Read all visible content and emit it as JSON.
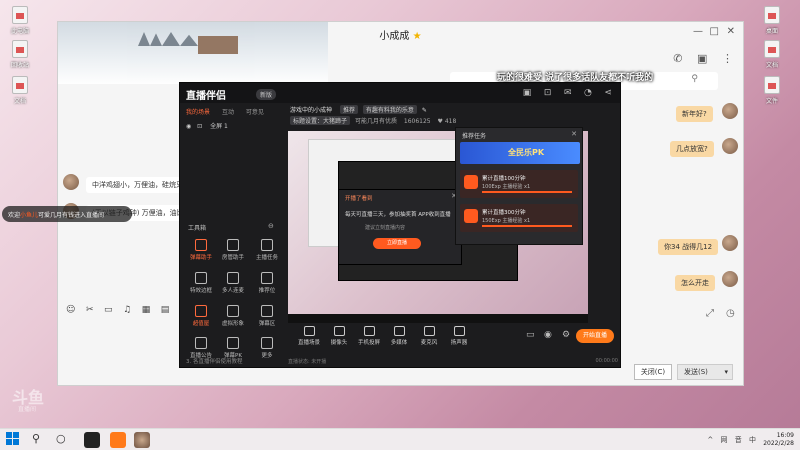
{
  "desktop": {
    "icons": [
      {
        "label": "此电脑",
        "side": "left"
      },
      {
        "label": "回收站",
        "side": "left"
      },
      {
        "label": "文档",
        "side": "left"
      },
      {
        "label": "桌面",
        "side": "right"
      },
      {
        "label": "文档",
        "side": "right"
      },
      {
        "label": "文件",
        "side": "right"
      }
    ]
  },
  "chat": {
    "title": "小成成",
    "title_badge": "★",
    "icons": [
      "phone-icon",
      "video-icon",
      "more-icon"
    ],
    "messages_left": [
      "中洋鸡翅小，万俚油，硅烷牙",
      "(无以链子鸡钟) 万俚油，油比，"
    ],
    "messages_right": [
      "新年好?",
      "几点放宽?",
      "你34 战得几12",
      "怎么开走"
    ],
    "toolbar_icons": [
      "smile-icon",
      "cut-icon",
      "folder-icon",
      "music-icon",
      "image-icon",
      "screen-icon"
    ],
    "close_label": "关闭(C)",
    "send_label": "发送(S)"
  },
  "overlay": {
    "caption": "玩的很难受 说了很多话队友都不听我的",
    "welcome_prefix": "欢迎",
    "welcome_name": "小鱼儿",
    "welcome_suffix": "可爱几月有钱进入直播间",
    "watermark": "斗鱼",
    "watermark_sub": "直播间"
  },
  "stream": {
    "brand": "直播伴侣",
    "badge": "新版",
    "source_tabs": [
      "我的场景",
      "互动",
      "可意见"
    ],
    "source_item": "全屏 1",
    "game_title": "游戏中的小成神",
    "game_tags": [
      "推荐",
      "有趣有料我的乐意"
    ],
    "game_sub": "标题设置：大猪蹄子",
    "game_stats": [
      "可能几月有优质",
      "1606125",
      "418"
    ],
    "tools_label": "工具箱",
    "tools": [
      "弹幕助手",
      "房管助手",
      "主播任务",
      "特效边框",
      "多人连麦",
      "推荐位",
      "超值屋",
      "虚拟形象",
      "弹幕区",
      "直播公告",
      "弹幕PK",
      "更多"
    ],
    "left_footer": "3. 各直播伴侣使用教程",
    "ad_popup": {
      "title": "开播了看到",
      "body": "每天可直播三天，参加抽奖首 APP收到直播",
      "sub": "建议立刻直播内容",
      "button": "立即直播"
    },
    "task_panel": {
      "header": "推荐任务",
      "banner_text": "全民乐PK",
      "tasks": [
        {
          "name": "累计直播100分钟",
          "desc": "100Exp 主播经验 x1"
        },
        {
          "name": "累计直播300分钟",
          "desc": "150Exp 主播经验 x1"
        }
      ]
    },
    "bottom_tools": [
      "直播场景",
      "摄像头",
      "手机投屏",
      "多媒体",
      "麦克风",
      "扬声器"
    ],
    "go_live": "开始直播",
    "status_text": "直播状态: 未开播",
    "timer": "00:00:00"
  },
  "taskbar": {
    "tray": [
      "^",
      "网",
      "音",
      "中"
    ],
    "time": "16:09",
    "date": "2022/2/28"
  }
}
